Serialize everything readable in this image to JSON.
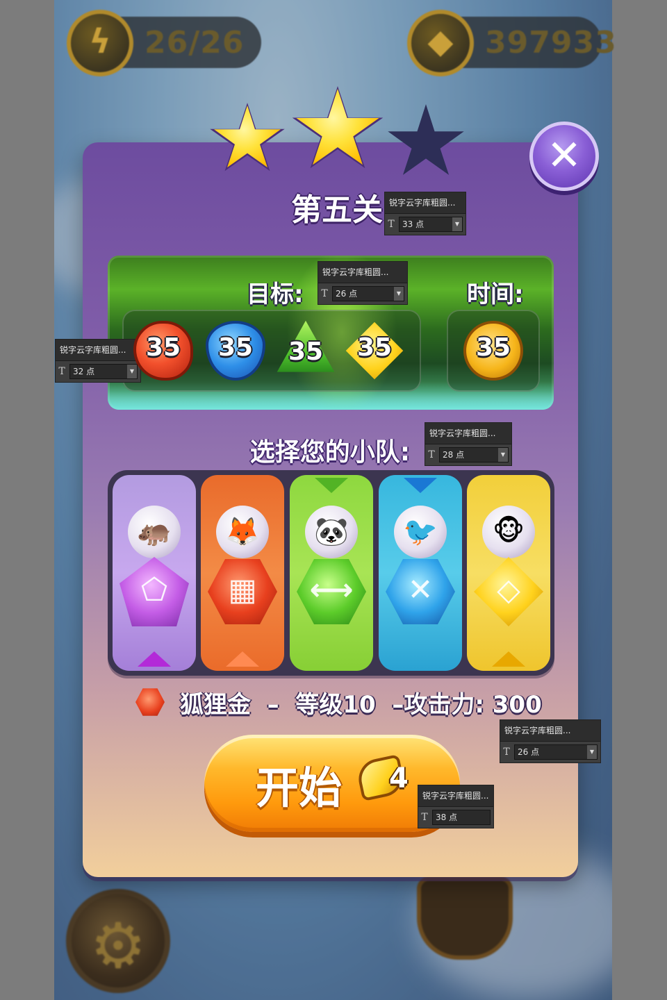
{
  "hud": {
    "energy_icon": "lightning-icon",
    "energy_value": "26/26",
    "gem_icon": "diamond-icon",
    "gem_value": "397933"
  },
  "stars": {
    "earned": 2,
    "total": 3
  },
  "level": {
    "title": "第五关"
  },
  "goals": {
    "target_label": "目标:",
    "time_label": "时间:",
    "items": [
      {
        "color": "red",
        "value": "35"
      },
      {
        "color": "blue",
        "value": "35"
      },
      {
        "color": "green",
        "value": "35"
      },
      {
        "color": "yellow",
        "value": "35"
      }
    ],
    "time_value": "35"
  },
  "team": {
    "label": "选择您的小队:",
    "members": [
      {
        "pet": "hippo",
        "color": "purple",
        "gem_icon": "pentagon-gem-icon"
      },
      {
        "pet": "fox",
        "color": "orange",
        "gem_icon": "grid-gem-icon"
      },
      {
        "pet": "panda",
        "color": "green",
        "gem_icon": "arrows-horizontal-gem-icon"
      },
      {
        "pet": "bird",
        "color": "blue",
        "gem_icon": "cross-arrows-gem-icon"
      },
      {
        "pet": "monkey",
        "color": "yellow",
        "gem_icon": "diamond-gem-icon"
      }
    ],
    "selected_info": "狐狸金  –  等级10  –攻击力: 300"
  },
  "start_button": {
    "label": "开始",
    "cost": "4"
  },
  "close_button": {
    "icon": "close-icon"
  },
  "font_tips": [
    {
      "font": "锐字云字库粗圆...",
      "size": "33 点"
    },
    {
      "font": "锐字云字库粗圆...",
      "size": "26 点"
    },
    {
      "font": "锐字云字库粗圆...",
      "size": "32 点"
    },
    {
      "font": "锐字云字库粗圆...",
      "size": "28 点"
    },
    {
      "font": "锐字云字库粗圆...",
      "size": "26 点"
    },
    {
      "font": "锐字云字库粗圆...",
      "size": "38 点"
    }
  ],
  "colors": {
    "panel_top": "#6d4c9f",
    "panel_bottom": "#f2cf9c",
    "start_button": "#ff9a0d",
    "star_gold": "#ffc107",
    "close_button": "#8a5fd6"
  }
}
